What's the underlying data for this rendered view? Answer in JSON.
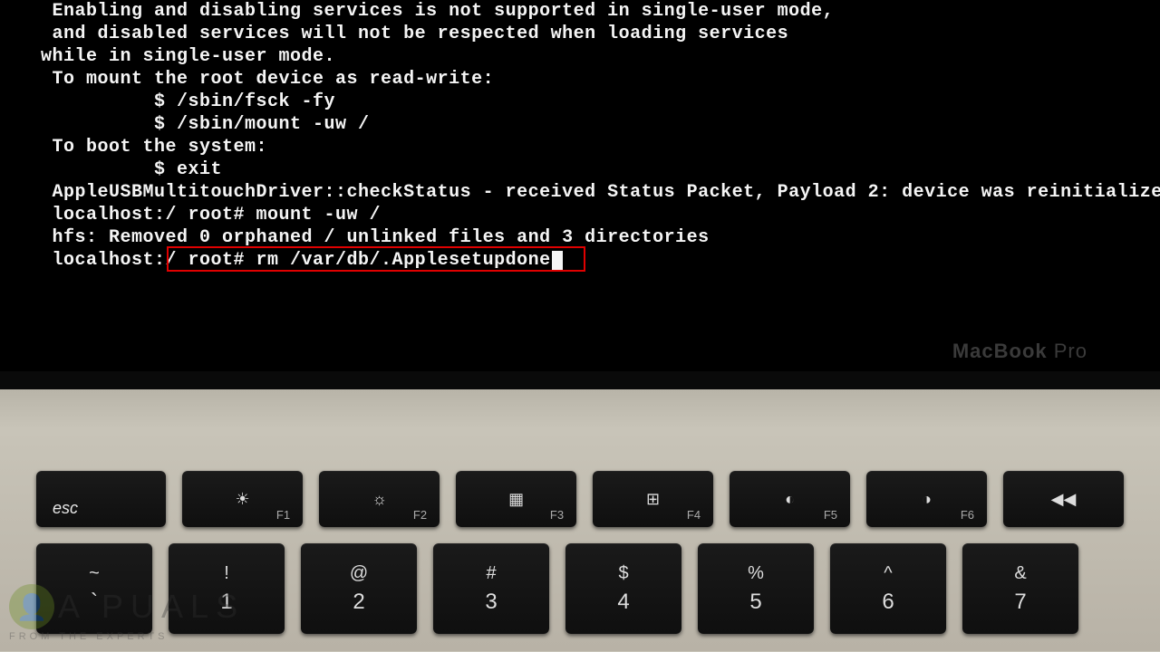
{
  "terminal": {
    "lines": [
      " Enabling and disabling services is not supported in single-user mode,",
      " and disabled services will not be respected when loading services",
      "while in single-user mode.",
      " To mount the root device as read-write:",
      "          $ /sbin/fsck -fy",
      "          $ /sbin/mount -uw /",
      " To boot the system:",
      "          $ exit",
      " AppleUSBMultitouchDriver::checkStatus - received Status Packet, Payload 2: device was reinitialize",
      " localhost:/ root# mount -uw /",
      " hfs: Removed 0 orphaned / unlinked files and 3 directories"
    ],
    "promptLine": " localhost:/ root# rm /var/db/.Applesetupdone",
    "highlightedCommand": "rm /var/db/.Applesetupdone"
  },
  "laptop": {
    "brandLabel": "MacBook",
    "brandSuffix": "Pro"
  },
  "keyboard": {
    "row1": [
      {
        "type": "esc",
        "label": "esc"
      },
      {
        "type": "fn",
        "icon": "☀",
        "sub": "F1"
      },
      {
        "type": "fn",
        "icon": "☼",
        "sub": "F2"
      },
      {
        "type": "fn",
        "icon": "▦",
        "sub": "F3"
      },
      {
        "type": "fn",
        "icon": "⊞",
        "sub": "F4"
      },
      {
        "type": "fn",
        "icon": "◐",
        "sub": "F5"
      },
      {
        "type": "fn",
        "icon": "◑",
        "sub": "F6"
      },
      {
        "type": "fn",
        "icon": "◀◀",
        "sub": ""
      }
    ],
    "row2": [
      {
        "top": "~",
        "bottom": "`"
      },
      {
        "top": "!",
        "bottom": "1"
      },
      {
        "top": "@",
        "bottom": "2"
      },
      {
        "top": "#",
        "bottom": "3"
      },
      {
        "top": "$",
        "bottom": "4"
      },
      {
        "top": "%",
        "bottom": "5"
      },
      {
        "top": "^",
        "bottom": "6"
      },
      {
        "top": "&",
        "bottom": "7"
      }
    ]
  },
  "watermark": {
    "brand": "A PUALS",
    "tagline": "FROM THE EXPERTS"
  }
}
